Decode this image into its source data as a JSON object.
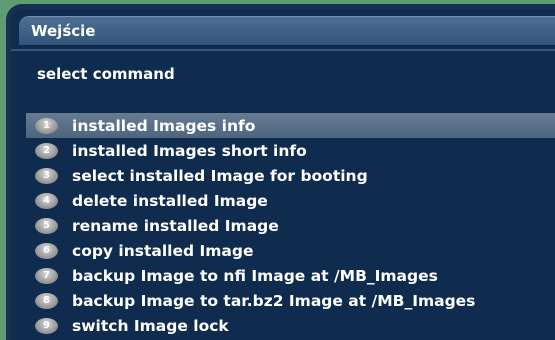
{
  "window": {
    "title": "Wejście",
    "subtitle": "select command"
  },
  "menu": {
    "selected_index": 0,
    "items": [
      {
        "num": "1",
        "label": "installed Images info"
      },
      {
        "num": "2",
        "label": "installed Images short info"
      },
      {
        "num": "3",
        "label": "select installed Image for booting"
      },
      {
        "num": "4",
        "label": "delete installed Image"
      },
      {
        "num": "5",
        "label": "rename installed Image"
      },
      {
        "num": "6",
        "label": "copy installed Image"
      },
      {
        "num": "7",
        "label": "backup  Image to nfi Image at /MB_Images"
      },
      {
        "num": "8",
        "label": "backup  Image to tar.bz2 Image at /MB_Images"
      },
      {
        "num": "9",
        "label": "switch Image lock"
      }
    ]
  },
  "colors": {
    "background": "#5f9c74",
    "panel": "#0f2c4f",
    "titlebar": "#4e6f93",
    "selection": "#5d728c",
    "text": "#ffffff"
  }
}
